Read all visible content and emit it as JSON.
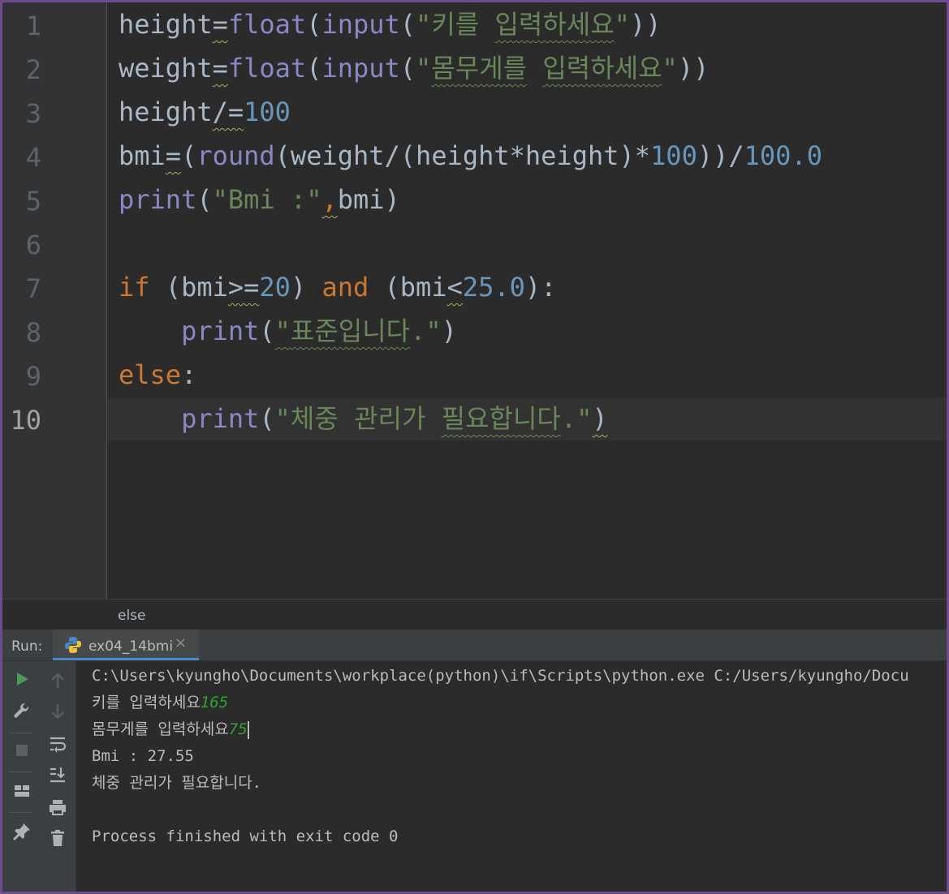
{
  "editor": {
    "line_numbers": [
      "1",
      "2",
      "3",
      "4",
      "5",
      "6",
      "7",
      "8",
      "9",
      "10"
    ],
    "current_line": "10",
    "lines": {
      "l1": {
        "t1": "height",
        "t2": "=",
        "t3": "float",
        "t4": "(",
        "t5": "input",
        "t6": "(",
        "t7": "\"키를 ",
        "t8": "입력하세요",
        "t9": "\"",
        "t10": "))"
      },
      "l2": {
        "t1": "weight",
        "t2": "=",
        "t3": "float",
        "t4": "(",
        "t5": "input",
        "t6": "(",
        "t7": "\"",
        "t8": "몸무게를",
        "t9": " ",
        "t10": "입력하세요",
        "t11": "\"",
        "t12": "))"
      },
      "l3": {
        "t1": "height",
        "t2": "/=",
        "t3": "100"
      },
      "l4": {
        "t1": "bmi",
        "t2": "=",
        "t3": "(",
        "t4": "round",
        "t5": "(weight/(height*height)*",
        "t6": "100",
        "t7": "))/",
        "t8": "100.0"
      },
      "l5": {
        "t1": "print",
        "t2": "(",
        "t3": "\"Bmi :\"",
        "t4": ",",
        "t5": "bmi)"
      },
      "l7": {
        "t1": "if",
        "t2": " (bmi",
        "t3": ">=",
        "t4": "20",
        "t5": ") ",
        "t6": "and",
        "t7": " (bmi",
        "t8": "<",
        "t9": "25.0",
        "t10": "):"
      },
      "l8": {
        "t0": "    ",
        "t1": "print",
        "t2": "(",
        "t3": "\"",
        "t4": "표준입니다",
        "t5": ".\"",
        "t6": ")"
      },
      "l9": {
        "t1": "else",
        "t2": ":"
      },
      "l10": {
        "t0": "    ",
        "t1": "print",
        "t2": "(",
        "t3": "\"체중 관리가 ",
        "t4": "필요합니다",
        "t5": ".\"",
        "t6": ")"
      }
    }
  },
  "breadcrumb": "else",
  "run_panel": {
    "label": "Run:",
    "tab_label": "ex04_14bmi",
    "tab_close": "×",
    "tab_icon": "python-icon",
    "toolbar_icons": [
      "rerun-icon",
      "wrench-icon",
      "stop-icon",
      "layout-icon",
      "pin-icon",
      "up-arrow-icon",
      "down-arrow-icon",
      "soft-wrap-icon",
      "scroll-to-end-icon",
      "print-icon",
      "trash-icon"
    ]
  },
  "console": {
    "command": "C:\\Users\\kyungho\\Documents\\workplace(python)\\if\\Scripts\\python.exe C:/Users/kyungho/Docu",
    "prompt1": "키를 입력하세요",
    "input1": "165",
    "prompt2": "몸무게를 입력하세요",
    "input2": "75",
    "output1": "Bmi : 27.55",
    "output2": "체중 관리가 필요합니다.",
    "exit": "Process finished with exit code 0"
  },
  "colors": {
    "keyword": "#cc7832",
    "builtin": "#8888c6",
    "number": "#6897bb",
    "string": "#6a8759",
    "default": "#a9b7c6",
    "background": "#2b2b2b",
    "console_input": "#33a02c",
    "frame": "#6e4a8e"
  }
}
